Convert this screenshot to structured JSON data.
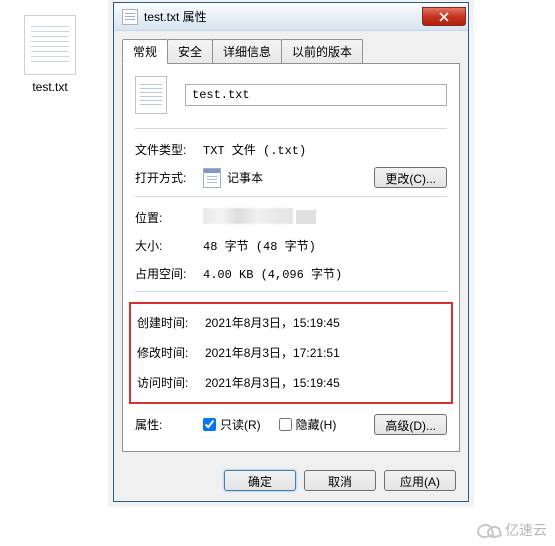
{
  "desktop": {
    "filename": "test.txt"
  },
  "dialog": {
    "title": "test.txt 属性",
    "tabs": {
      "general": "常规",
      "security": "安全",
      "details": "详细信息",
      "previous": "以前的版本"
    },
    "filename_value": "test.txt",
    "labels": {
      "filetype": "文件类型:",
      "opens_with": "打开方式:",
      "location": "位置:",
      "size": "大小:",
      "size_on_disk": "占用空间:",
      "created": "创建时间:",
      "modified": "修改时间:",
      "accessed": "访问时间:",
      "attributes": "属性:"
    },
    "values": {
      "filetype": "TXT 文件 (.txt)",
      "opens_with": "记事本",
      "size": "48 字节 (48 字节)",
      "size_on_disk": "4.00 KB (4,096 字节)",
      "created": "2021年8月3日，15:19:45",
      "modified": "2021年8月3日，17:21:51",
      "accessed": "2021年8月3日，15:19:45"
    },
    "checkboxes": {
      "readonly": "只读(R)",
      "hidden": "隐藏(H)"
    },
    "buttons": {
      "change": "更改(C)...",
      "advanced": "高级(D)...",
      "ok": "确定",
      "cancel": "取消",
      "apply": "应用(A)"
    }
  },
  "watermark": "亿速云"
}
